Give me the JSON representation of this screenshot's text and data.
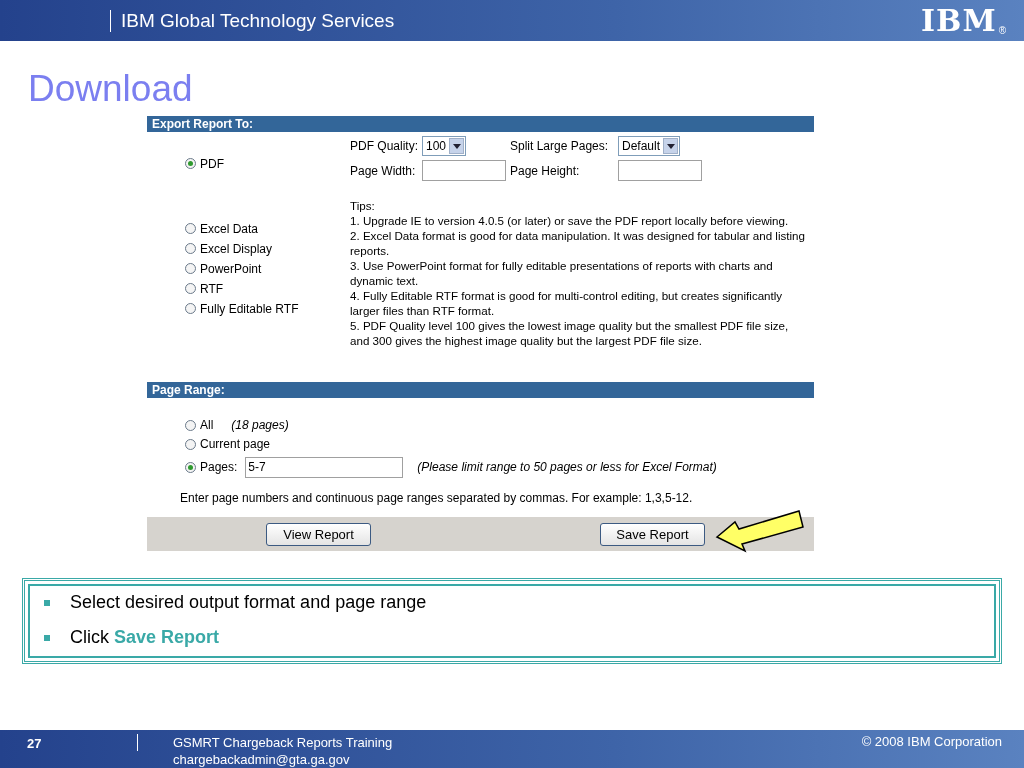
{
  "header": {
    "title": "IBM Global Technology Services",
    "logo": "IBM",
    "logo_mark": "®"
  },
  "slide_title": "Download",
  "export": {
    "header": "Export Report To:",
    "formats": [
      {
        "label": "PDF",
        "selected": true
      },
      {
        "label": "Excel Data",
        "selected": false
      },
      {
        "label": "Excel Display",
        "selected": false
      },
      {
        "label": "PowerPoint",
        "selected": false
      },
      {
        "label": "RTF",
        "selected": false
      },
      {
        "label": "Fully Editable RTF",
        "selected": false
      }
    ],
    "pdf_quality": {
      "label": "PDF Quality:",
      "value": "100"
    },
    "split_large_pages": {
      "label": "Split Large Pages:",
      "value": "Default"
    },
    "page_width": {
      "label": "Page Width:"
    },
    "page_height": {
      "label": "Page Height:"
    },
    "tips_title": "Tips:",
    "tips": [
      "1. Upgrade IE to version 4.0.5 (or later) or save the PDF report locally before viewing.",
      "2. Excel Data format is good for data manipulation. It was designed for tabular and listing reports.",
      "3. Use PowerPoint format for fully editable presentations of reports with charts and dynamic text.",
      "4. Fully Editable RTF format is good for multi-control editing, but creates significantly larger files than RTF format.",
      "5. PDF Quality level 100 gives the lowest image quality but the smallest PDF file size, and 300 gives the highest image quality but the largest PDF file size."
    ]
  },
  "page_range": {
    "header": "Page Range:",
    "options": [
      {
        "kind": "all",
        "label": "All",
        "note": "(18 pages)",
        "selected": false
      },
      {
        "kind": "current",
        "label": "Current page",
        "selected": false
      },
      {
        "kind": "pages",
        "label": "Pages:",
        "value": "5-7",
        "note": "(Please limit range to 50 pages or less for Excel Format)",
        "selected": true
      }
    ],
    "hint": "Enter page numbers and continuous page ranges separated by commas. For example: 1,3,5-12."
  },
  "buttons": [
    "View Report",
    "Save Report"
  ],
  "bullets": [
    "Select desired output format and page range",
    "Click **Save Report**"
  ],
  "footer": {
    "page": "27",
    "course": "GSMRT Chargeback Reports Training",
    "email": "chargebackadmin@gta.ga.gov",
    "copyright": "© 2008 IBM Corporation"
  }
}
